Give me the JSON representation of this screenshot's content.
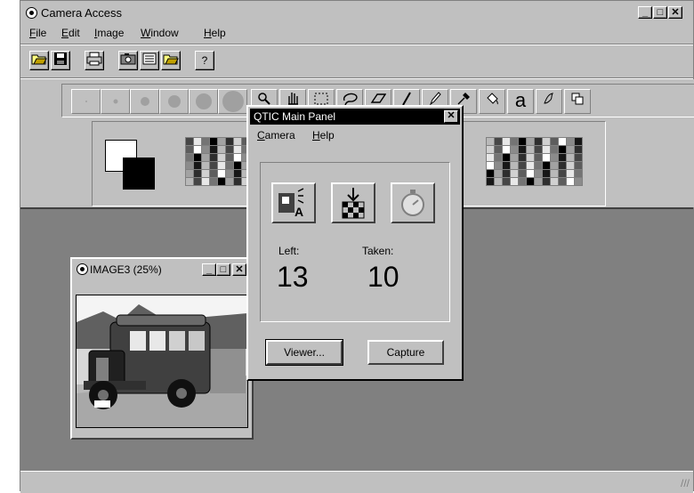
{
  "app": {
    "title": "Camera Access",
    "menu": [
      {
        "label": "File",
        "key": "F",
        "rest": "ile"
      },
      {
        "label": "Edit",
        "key": "E",
        "rest": "dit"
      },
      {
        "label": "Image",
        "key": "I",
        "rest": "mage"
      },
      {
        "label": "Window",
        "key": "W",
        "rest": "indow"
      },
      {
        "label": "Help",
        "key": "H",
        "rest": "elp"
      }
    ],
    "toolbar_icons": [
      "open-icon",
      "save-icon",
      "print-icon",
      "camera-icon",
      "scanner-icon",
      "open-folder-icon",
      "help-icon"
    ],
    "help_glyph": "?",
    "text_tool_glyph": "a"
  },
  "image_window": {
    "title": "IMAGE3 (25%)"
  },
  "dialog": {
    "title": "QTIC  Main Panel",
    "menu": [
      {
        "label": "Camera",
        "key": "C",
        "rest": "amera"
      },
      {
        "label": "Help",
        "key": "H",
        "rest": "elp"
      }
    ],
    "left_label": "Left:",
    "left_value": "13",
    "taken_label": "Taken:",
    "taken_value": "10",
    "viewer_button": "Viewer...",
    "capture_button": "Capture"
  },
  "colors": {
    "dialog_title_bg": "#000000",
    "workspace": "#808080",
    "chrome": "#c0c0c0"
  }
}
